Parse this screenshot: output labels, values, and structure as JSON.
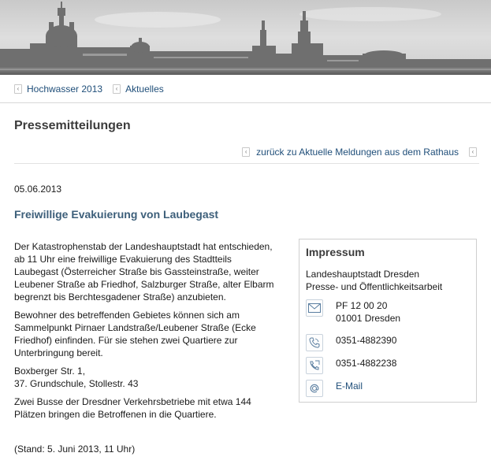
{
  "breadcrumb": [
    {
      "label": "Hochwasser 2013"
    },
    {
      "label": "Aktuelles"
    }
  ],
  "page_title": "Pressemitteilungen",
  "back_link": "zurück zu Aktuelle Meldungen aus dem Rathaus",
  "article": {
    "date": "05.06.2013",
    "headline": "Freiwillige Evakuierung von Laubegast",
    "paragraphs": [
      [
        "Der Katastrophenstab der Landeshauptstadt hat entschieden,",
        "ab 11 Uhr eine freiwillige Evakuierung des Stadtteils",
        "Laubegast (Österreicher Straße bis Gassteinstraße, weiter",
        "Leubener Straße ab Friedhof, Salzburger Straße, alter Elbarm",
        "begrenzt bis Berchtesgadener Straße) anzubieten."
      ],
      [
        "Bewohner des betreffenden Gebietes können sich am",
        "Sammelpunkt Pirnaer Landstraße/Leubener Straße (Ecke",
        "Friedhof) einfinden. Für sie stehen zwei Quartiere zur",
        "Unterbringung bereit."
      ],
      [
        "Boxberger Str. 1,",
        "37. Grundschule, Stollestr. 43"
      ],
      [
        "Zwei Busse der Dresdner Verkehrsbetriebe mit etwa 144",
        "Plätzen bringen die Betroffenen in die Quartiere."
      ]
    ],
    "stand": "(Stand: 5. Juni 2013, 11 Uhr)"
  },
  "impressum": {
    "title": "Impressum",
    "org_line1": "Landeshauptstadt Dresden",
    "org_line2": "Presse- und Öffentlichkeitsarbeit",
    "postbox_line1": "PF 12 00 20",
    "postbox_line2": "01001 Dresden",
    "phone": "0351-4882390",
    "fax": "0351-4882238",
    "email_label": "E-Mail",
    "icons": {
      "postbox": "envelope-icon",
      "phone": "phone-icon",
      "fax": "fax-icon",
      "email": "at-sign-icon"
    }
  },
  "colors": {
    "link": "#1f4e79",
    "headline": "#3d5f7a",
    "title": "#3c3c3c",
    "divider": "#d7d7d7"
  }
}
